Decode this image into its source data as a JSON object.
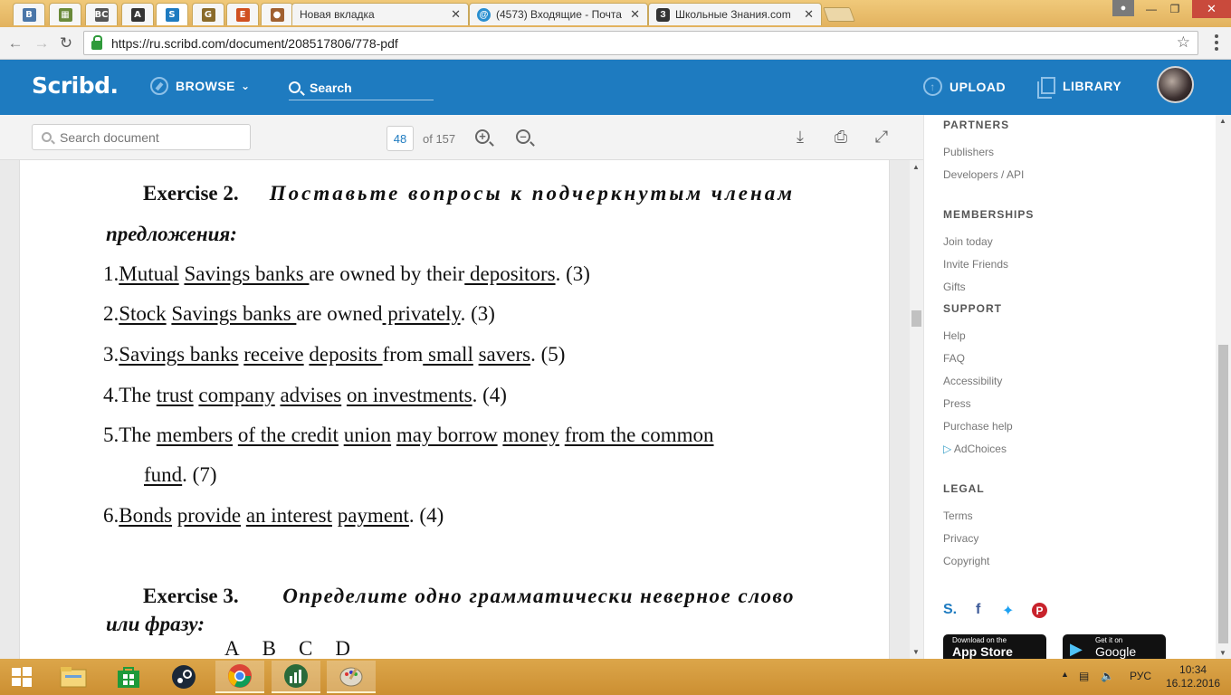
{
  "browser": {
    "tabs": [
      {
        "name": "vk-tab",
        "icon": "B",
        "color": "#4a76a8"
      },
      {
        "name": "tab-2",
        "icon": "▦",
        "color": "#6a8a3a"
      },
      {
        "name": "bc-tab",
        "icon": "BC",
        "color": "#555"
      },
      {
        "name": "tab-4",
        "icon": "A",
        "color": "#333"
      },
      {
        "name": "scribd-tab",
        "icon": "S",
        "color": "#1e7bc0"
      },
      {
        "name": "tab-6",
        "icon": "G",
        "color": "#8a6a2a"
      },
      {
        "name": "tab-7",
        "icon": "E",
        "color": "#d05020"
      },
      {
        "name": "tab-8",
        "icon": "●",
        "color": "#a06030"
      }
    ],
    "wide_tabs": [
      {
        "title": "Новая вкладка",
        "icon": "",
        "close": "✕"
      },
      {
        "title": "(4573) Входящие - Почта",
        "icon": "@",
        "close": "✕"
      },
      {
        "title": "Школьные Знания.com",
        "icon": "З",
        "close": "✕"
      }
    ],
    "url": "https://ru.scribd.com/document/208517806/778-pdf",
    "minimize": "—",
    "maximize": "❐",
    "close": "✕"
  },
  "header": {
    "logo": "Scribd.",
    "browse": "BROWSE",
    "search": "Search",
    "upload": "UPLOAD",
    "library": "LIBRARY"
  },
  "toolbar": {
    "search_placeholder": "Search document",
    "page_current": "48",
    "page_of": "of 157"
  },
  "document": {
    "ex2_head": "Exercise 2.",
    "ex2_title_1": "Поставьте вопросы к подчеркнутым членам",
    "ex2_title_2": "предложения:",
    "lines": [
      {
        "num": "1.",
        "parts": [
          [
            "Mutual",
            true
          ],
          [
            " ",
            false
          ],
          [
            "Savings banks ",
            true
          ],
          [
            "are owned by their",
            false
          ],
          [
            " depositors",
            true
          ],
          [
            ". (3)",
            false
          ]
        ]
      },
      {
        "num": "2.",
        "parts": [
          [
            "Stock",
            true
          ],
          [
            " ",
            false
          ],
          [
            "Savings banks ",
            true
          ],
          [
            "are owned",
            false
          ],
          [
            " privately",
            true
          ],
          [
            ". (3)",
            false
          ]
        ]
      },
      {
        "num": "3.",
        "parts": [
          [
            "Savings banks",
            true
          ],
          [
            " ",
            false
          ],
          [
            "receive",
            true
          ],
          [
            " ",
            false
          ],
          [
            "deposits ",
            true
          ],
          [
            "from",
            false
          ],
          [
            " small",
            true
          ],
          [
            " ",
            false
          ],
          [
            "savers",
            true
          ],
          [
            ". (5)",
            false
          ]
        ]
      },
      {
        "num": "4.",
        "parts": [
          [
            "The ",
            false
          ],
          [
            "trust",
            true
          ],
          [
            " ",
            false
          ],
          [
            "company",
            true
          ],
          [
            " ",
            false
          ],
          [
            "advises",
            true
          ],
          [
            " ",
            false
          ],
          [
            "on investments",
            true
          ],
          [
            ". (4)",
            false
          ]
        ]
      },
      {
        "num": "5.",
        "parts": [
          [
            "The ",
            false
          ],
          [
            "members",
            true
          ],
          [
            " ",
            false
          ],
          [
            "of the credit",
            true
          ],
          [
            " ",
            false
          ],
          [
            "union",
            true
          ],
          [
            " ",
            false
          ],
          [
            "may borrow",
            true
          ],
          [
            " ",
            false
          ],
          [
            "money",
            true
          ],
          [
            " ",
            false
          ],
          [
            "from the common",
            true
          ]
        ]
      },
      {
        "num": "",
        "parts": [
          [
            "fund",
            true
          ],
          [
            ". (7)",
            false
          ]
        ]
      },
      {
        "num": "6.",
        "parts": [
          [
            "Bonds",
            true
          ],
          [
            " ",
            false
          ],
          [
            "provide",
            true
          ],
          [
            " ",
            false
          ],
          [
            "an interest",
            true
          ],
          [
            " ",
            false
          ],
          [
            "payment",
            true
          ],
          [
            ". (4)",
            false
          ]
        ]
      }
    ],
    "ex3_head": "Exercise 3.",
    "ex3_title_1": "Определите одно грамматически неверное слово",
    "ex3_title_2": "или фразу:",
    "choices": [
      "A",
      "B",
      "C",
      "D"
    ]
  },
  "sidebar": {
    "partners": "PARTNERS",
    "partner_links": [
      "Publishers",
      "Developers / API"
    ],
    "memberships": "MEMBERSHIPS",
    "membership_links": [
      "Join today",
      "Invite Friends",
      "Gifts"
    ],
    "support": "SUPPORT",
    "support_links": [
      "Help",
      "FAQ",
      "Accessibility",
      "Press",
      "Purchase help"
    ],
    "adchoices": "AdChoices",
    "legal": "LEGAL",
    "legal_links": [
      "Terms",
      "Privacy",
      "Copyright"
    ],
    "appstore_small": "Download on the",
    "appstore_big": "App Store",
    "gplay_small": "Get it on",
    "gplay_big": "Google play"
  },
  "taskbar": {
    "lang": "РУС",
    "time": "10:34",
    "date": "16.12.2016"
  }
}
